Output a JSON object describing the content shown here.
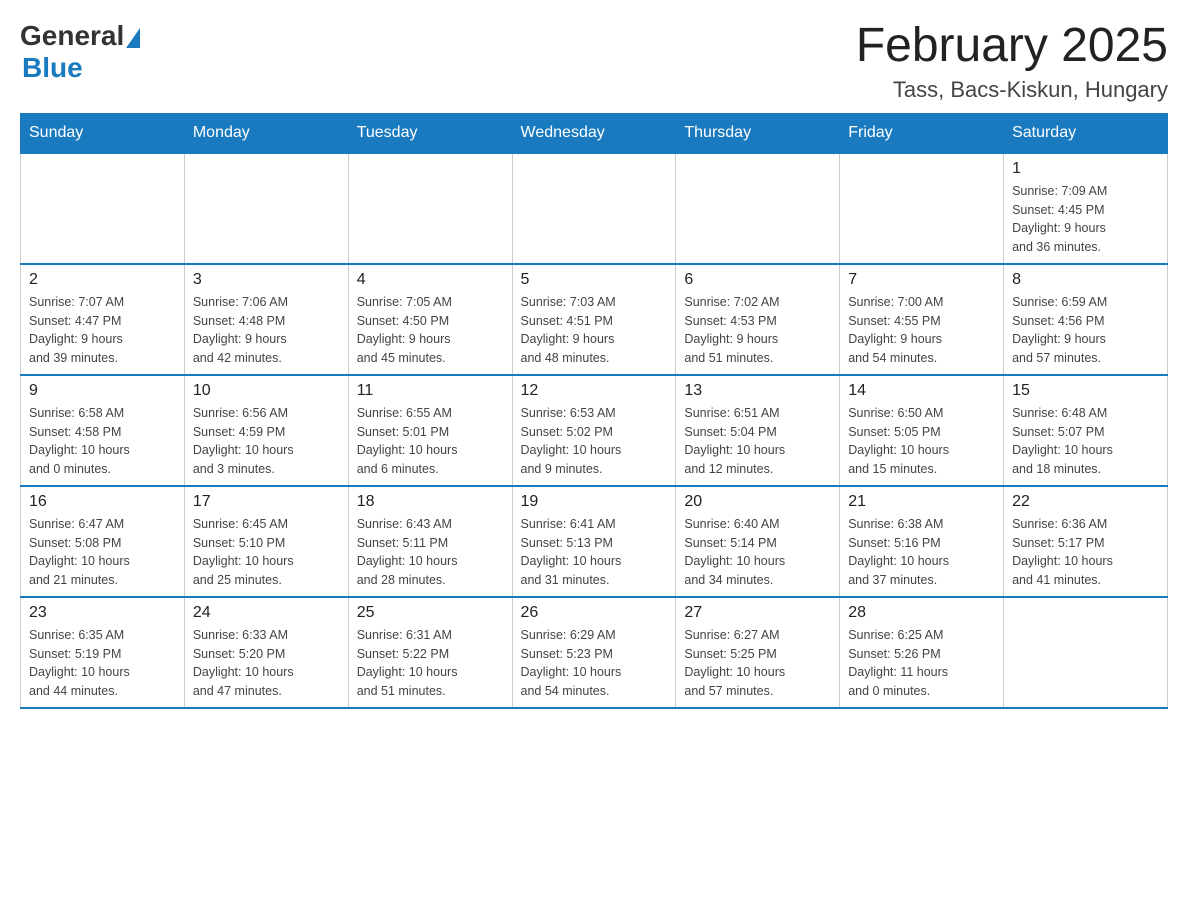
{
  "logo": {
    "general": "General",
    "blue": "Blue"
  },
  "title": "February 2025",
  "location": "Tass, Bacs-Kiskun, Hungary",
  "days_of_week": [
    "Sunday",
    "Monday",
    "Tuesday",
    "Wednesday",
    "Thursday",
    "Friday",
    "Saturday"
  ],
  "weeks": [
    [
      {
        "day": "",
        "info": ""
      },
      {
        "day": "",
        "info": ""
      },
      {
        "day": "",
        "info": ""
      },
      {
        "day": "",
        "info": ""
      },
      {
        "day": "",
        "info": ""
      },
      {
        "day": "",
        "info": ""
      },
      {
        "day": "1",
        "info": "Sunrise: 7:09 AM\nSunset: 4:45 PM\nDaylight: 9 hours\nand 36 minutes."
      }
    ],
    [
      {
        "day": "2",
        "info": "Sunrise: 7:07 AM\nSunset: 4:47 PM\nDaylight: 9 hours\nand 39 minutes."
      },
      {
        "day": "3",
        "info": "Sunrise: 7:06 AM\nSunset: 4:48 PM\nDaylight: 9 hours\nand 42 minutes."
      },
      {
        "day": "4",
        "info": "Sunrise: 7:05 AM\nSunset: 4:50 PM\nDaylight: 9 hours\nand 45 minutes."
      },
      {
        "day": "5",
        "info": "Sunrise: 7:03 AM\nSunset: 4:51 PM\nDaylight: 9 hours\nand 48 minutes."
      },
      {
        "day": "6",
        "info": "Sunrise: 7:02 AM\nSunset: 4:53 PM\nDaylight: 9 hours\nand 51 minutes."
      },
      {
        "day": "7",
        "info": "Sunrise: 7:00 AM\nSunset: 4:55 PM\nDaylight: 9 hours\nand 54 minutes."
      },
      {
        "day": "8",
        "info": "Sunrise: 6:59 AM\nSunset: 4:56 PM\nDaylight: 9 hours\nand 57 minutes."
      }
    ],
    [
      {
        "day": "9",
        "info": "Sunrise: 6:58 AM\nSunset: 4:58 PM\nDaylight: 10 hours\nand 0 minutes."
      },
      {
        "day": "10",
        "info": "Sunrise: 6:56 AM\nSunset: 4:59 PM\nDaylight: 10 hours\nand 3 minutes."
      },
      {
        "day": "11",
        "info": "Sunrise: 6:55 AM\nSunset: 5:01 PM\nDaylight: 10 hours\nand 6 minutes."
      },
      {
        "day": "12",
        "info": "Sunrise: 6:53 AM\nSunset: 5:02 PM\nDaylight: 10 hours\nand 9 minutes."
      },
      {
        "day": "13",
        "info": "Sunrise: 6:51 AM\nSunset: 5:04 PM\nDaylight: 10 hours\nand 12 minutes."
      },
      {
        "day": "14",
        "info": "Sunrise: 6:50 AM\nSunset: 5:05 PM\nDaylight: 10 hours\nand 15 minutes."
      },
      {
        "day": "15",
        "info": "Sunrise: 6:48 AM\nSunset: 5:07 PM\nDaylight: 10 hours\nand 18 minutes."
      }
    ],
    [
      {
        "day": "16",
        "info": "Sunrise: 6:47 AM\nSunset: 5:08 PM\nDaylight: 10 hours\nand 21 minutes."
      },
      {
        "day": "17",
        "info": "Sunrise: 6:45 AM\nSunset: 5:10 PM\nDaylight: 10 hours\nand 25 minutes."
      },
      {
        "day": "18",
        "info": "Sunrise: 6:43 AM\nSunset: 5:11 PM\nDaylight: 10 hours\nand 28 minutes."
      },
      {
        "day": "19",
        "info": "Sunrise: 6:41 AM\nSunset: 5:13 PM\nDaylight: 10 hours\nand 31 minutes."
      },
      {
        "day": "20",
        "info": "Sunrise: 6:40 AM\nSunset: 5:14 PM\nDaylight: 10 hours\nand 34 minutes."
      },
      {
        "day": "21",
        "info": "Sunrise: 6:38 AM\nSunset: 5:16 PM\nDaylight: 10 hours\nand 37 minutes."
      },
      {
        "day": "22",
        "info": "Sunrise: 6:36 AM\nSunset: 5:17 PM\nDaylight: 10 hours\nand 41 minutes."
      }
    ],
    [
      {
        "day": "23",
        "info": "Sunrise: 6:35 AM\nSunset: 5:19 PM\nDaylight: 10 hours\nand 44 minutes."
      },
      {
        "day": "24",
        "info": "Sunrise: 6:33 AM\nSunset: 5:20 PM\nDaylight: 10 hours\nand 47 minutes."
      },
      {
        "day": "25",
        "info": "Sunrise: 6:31 AM\nSunset: 5:22 PM\nDaylight: 10 hours\nand 51 minutes."
      },
      {
        "day": "26",
        "info": "Sunrise: 6:29 AM\nSunset: 5:23 PM\nDaylight: 10 hours\nand 54 minutes."
      },
      {
        "day": "27",
        "info": "Sunrise: 6:27 AM\nSunset: 5:25 PM\nDaylight: 10 hours\nand 57 minutes."
      },
      {
        "day": "28",
        "info": "Sunrise: 6:25 AM\nSunset: 5:26 PM\nDaylight: 11 hours\nand 0 minutes."
      },
      {
        "day": "",
        "info": ""
      }
    ]
  ]
}
